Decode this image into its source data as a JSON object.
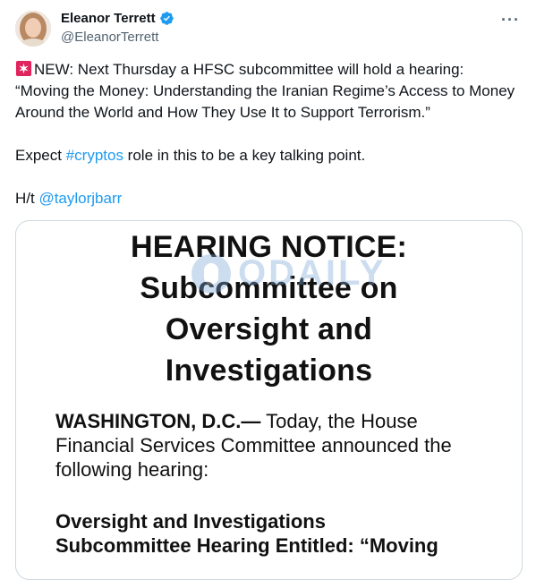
{
  "author": {
    "display_name": "Eleanor Terrett",
    "handle": "@EleanorTerrett",
    "verified": true
  },
  "icons": {
    "more": "more-dots-icon",
    "verified": "verified-badge-icon",
    "siren": "siren-emoji-icon"
  },
  "tweet": {
    "line1": "NEW: Next Thursday a HFSC subcommittee will hold a hearing: “Moving the Money: Understanding the Iranian Regime’s Access to Money Around the World and How They Use It to Support Terrorism.”",
    "line2_before": "Expect ",
    "line2_hashtag": "#cryptos",
    "line2_after": " role in this to be a key talking point.",
    "line3_before": "H/t ",
    "line3_mention": "@taylorjbarr"
  },
  "media": {
    "title_line1": "HEARING NOTICE:",
    "title_line2": "Subcommittee on",
    "title_line3": "Oversight and",
    "title_line4": "Investigations",
    "watermark": "ODAILY",
    "body_bold": "WASHINGTON, D.C.—",
    "body_rest": " Today, the House Financial Services Committee announced the following hearing:",
    "heading_line1": "Oversight and Investigations",
    "heading_line2": "Subcommittee Hearing Entitled: “Moving"
  },
  "colors": {
    "link": "#1d9bf0",
    "verified": "#1d9bf0",
    "muted": "#536471"
  }
}
